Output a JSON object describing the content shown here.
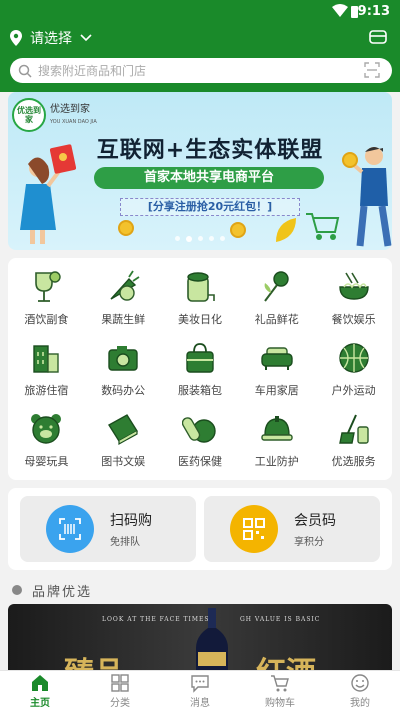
{
  "status_bar": {
    "time": "9:13"
  },
  "header": {
    "location_label": "请选择",
    "search_placeholder": "搜索附近商品和门店"
  },
  "banner": {
    "logo_text": "优选到家",
    "logo_subtext": "YOU XUAN DAO JIA",
    "title": "互联网+生态实体联盟",
    "subtitle": "首家本地共享电商平台",
    "promo": "[分享注册抢20元红包！]",
    "page_count": 5,
    "active_page": 1
  },
  "categories": [
    {
      "label": "酒饮副食",
      "icon": "wine-glass-icon"
    },
    {
      "label": "果蔬生鲜",
      "icon": "vegetable-icon"
    },
    {
      "label": "美妆日化",
      "icon": "paper-roll-icon"
    },
    {
      "label": "礼品鲜花",
      "icon": "flower-icon"
    },
    {
      "label": "餐饮娱乐",
      "icon": "noodle-bowl-icon"
    },
    {
      "label": "旅游住宿",
      "icon": "building-icon"
    },
    {
      "label": "数码办公",
      "icon": "camera-icon"
    },
    {
      "label": "服装箱包",
      "icon": "handbag-icon"
    },
    {
      "label": "车用家居",
      "icon": "sofa-icon"
    },
    {
      "label": "户外运动",
      "icon": "basketball-icon"
    },
    {
      "label": "母婴玩具",
      "icon": "teddy-bear-icon"
    },
    {
      "label": "图书文娱",
      "icon": "book-icon"
    },
    {
      "label": "医药保健",
      "icon": "pills-icon"
    },
    {
      "label": "工业防护",
      "icon": "helmet-icon"
    },
    {
      "label": "优选服务",
      "icon": "cleaning-icon"
    }
  ],
  "quick_actions": [
    {
      "title": "扫码购",
      "subtitle": "免排队",
      "icon": "barcode-scan-icon",
      "color": "#3aa3ee"
    },
    {
      "title": "会员码",
      "subtitle": "享积分",
      "icon": "qr-code-icon",
      "color": "#f4b400"
    }
  ],
  "brand": {
    "title": "品牌优选",
    "banner_tag_left": "LOOK AT THE FACE TIMES",
    "banner_tag_right": "GH VALUE IS BASIC",
    "banner_text_left": "臻品",
    "banner_text_right": "红酒"
  },
  "nav": [
    {
      "label": "主页",
      "icon": "home-icon",
      "active": true
    },
    {
      "label": "分类",
      "icon": "grid-icon",
      "active": false
    },
    {
      "label": "消息",
      "icon": "message-icon",
      "active": false
    },
    {
      "label": "购物车",
      "icon": "cart-icon",
      "active": false
    },
    {
      "label": "我的",
      "icon": "profile-icon",
      "active": false
    }
  ],
  "colors": {
    "primary": "#1a8a2a",
    "icon_green": "#2e7d32",
    "icon_light": "#c8e6a0"
  }
}
